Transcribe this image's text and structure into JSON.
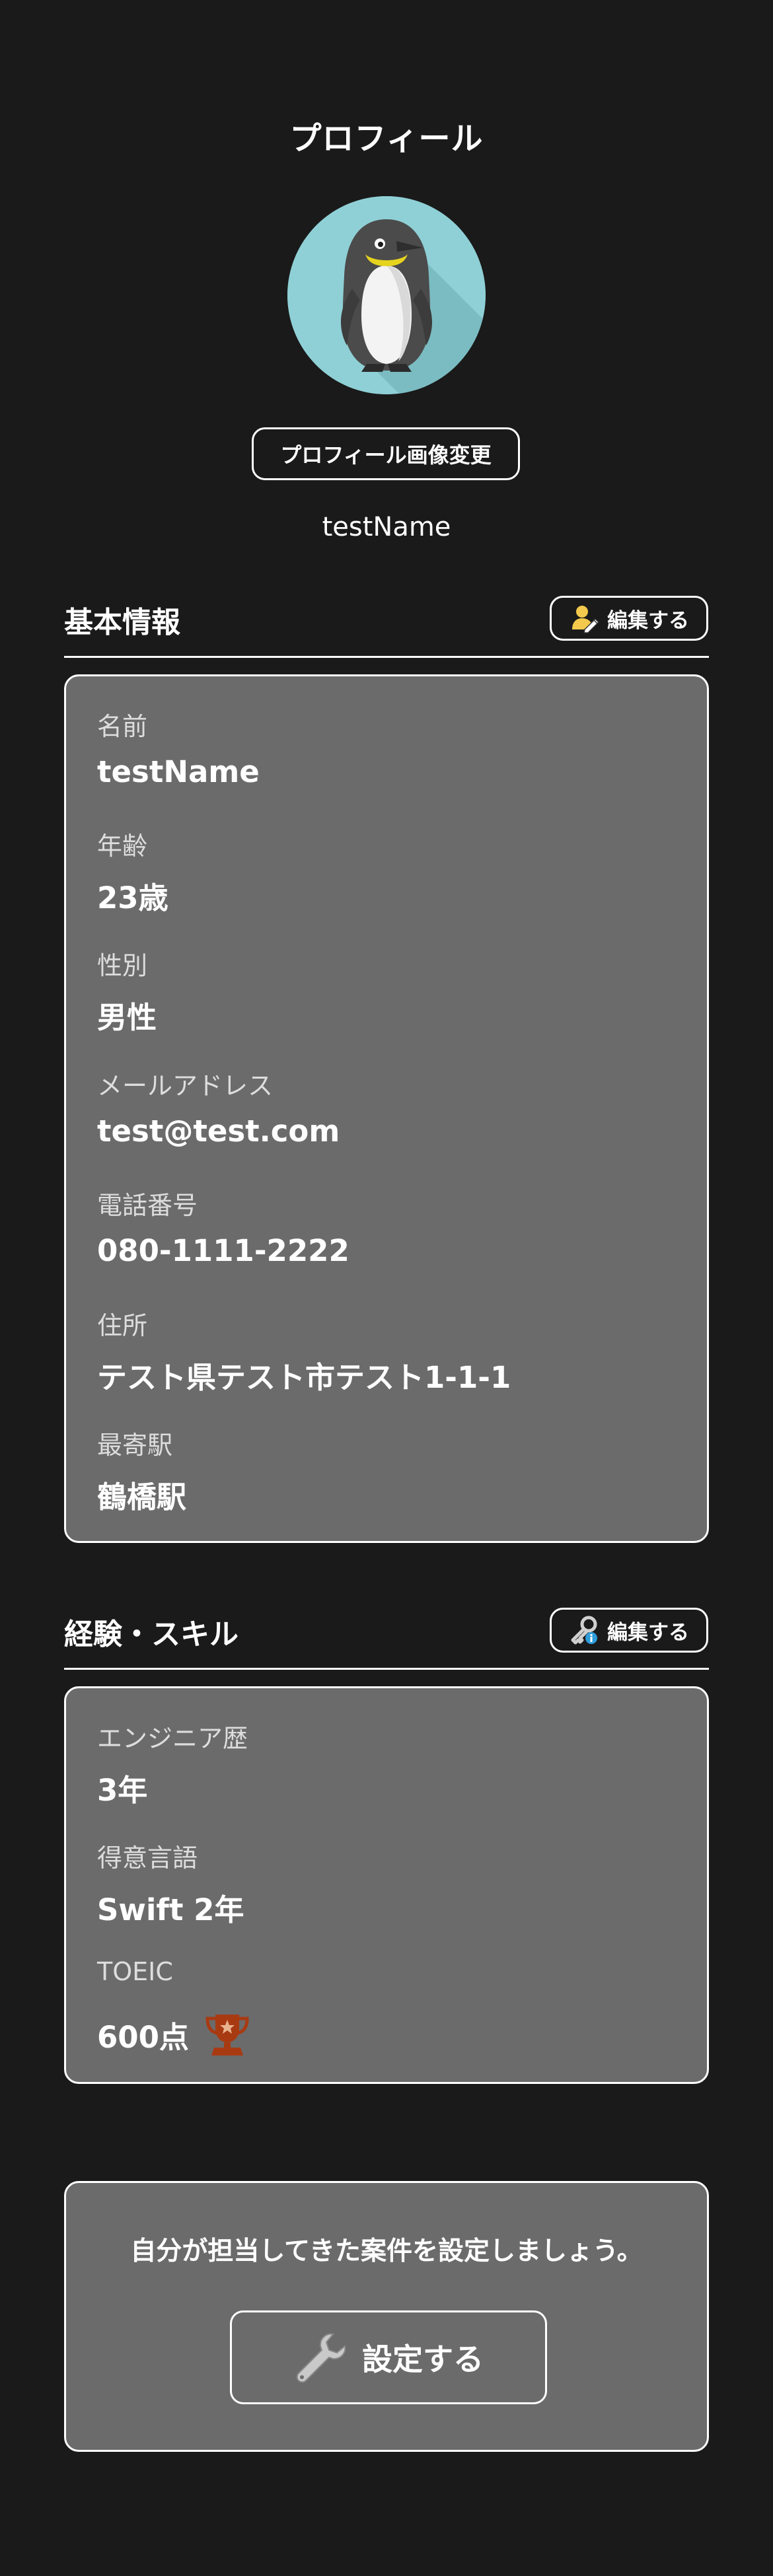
{
  "header": {
    "title": "プロフィール"
  },
  "profile": {
    "change_photo_label": "プロフィール画像変更",
    "username": "testName"
  },
  "basic_info": {
    "title": "基本情報",
    "edit_label": "編集する",
    "fields": [
      {
        "label": "名前",
        "value": "testName"
      },
      {
        "label": "年齢",
        "value": "23歳"
      },
      {
        "label": "性別",
        "value": "男性"
      },
      {
        "label": "メールアドレス",
        "value": "test@test.com"
      },
      {
        "label": "電話番号",
        "value": "080-1111-2222"
      },
      {
        "label": "住所",
        "value": "テスト県テスト市テスト1-1-1"
      },
      {
        "label": "最寄駅",
        "value": "鶴橋駅"
      }
    ]
  },
  "skills": {
    "title": "経験・スキル",
    "edit_label": "編集する",
    "fields": [
      {
        "label": "エンジニア歴",
        "value": "3年"
      },
      {
        "label": "得意言語",
        "value": "Swift  2年"
      },
      {
        "label": "TOEIC",
        "value": "600点"
      }
    ]
  },
  "projects": {
    "prompt": "自分が担当してきた案件を設定しましょう。",
    "setup_label": "設定する"
  },
  "icons": {
    "avatar": "penguin-icon",
    "basic_edit": "user-edit-icon",
    "skills_edit": "key-icon",
    "toeic_badge": "trophy-icon",
    "setup": "wrench-icon"
  },
  "colors": {
    "background": "#1a1a1a",
    "card": "#6b6b6b",
    "avatar_bg": "#8fd0d6",
    "trophy": "#a83a12"
  }
}
